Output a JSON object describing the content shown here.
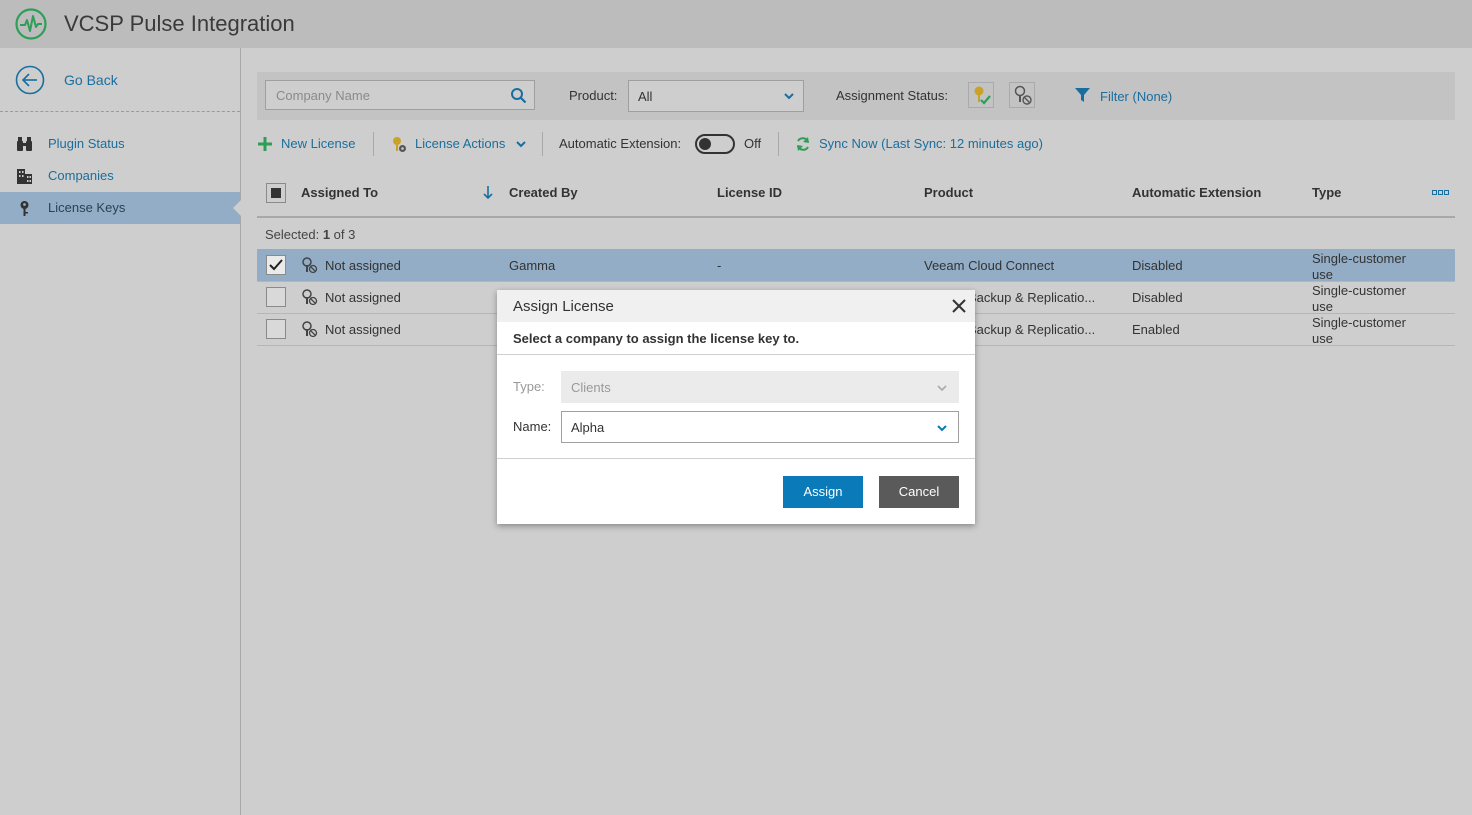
{
  "app": {
    "title": "VCSP Pulse Integration",
    "accent": "#2e9e57"
  },
  "sidebar": {
    "go_back": "Go Back",
    "items": [
      {
        "label": "Plugin Status",
        "icon": "binoculars-icon"
      },
      {
        "label": "Companies",
        "icon": "building-icon"
      },
      {
        "label": "License Keys",
        "icon": "key-icon",
        "active": true
      }
    ]
  },
  "filters": {
    "search_placeholder": "Company Name",
    "product_label": "Product:",
    "product_value": "All",
    "assignment_status_label": "Assignment Status:",
    "filter_link": "Filter (None)"
  },
  "toolbar": {
    "new_license": "New License",
    "license_actions": "License Actions",
    "auto_extension_label": "Automatic Extension:",
    "auto_extension_state": "Off",
    "sync_now": "Sync Now (Last Sync: 12 minutes ago)"
  },
  "table": {
    "columns": [
      "Assigned To",
      "Created By",
      "License ID",
      "Product",
      "Automatic Extension",
      "Type"
    ],
    "selection": {
      "prefix": "Selected: ",
      "count": "1",
      "suffix": " of 3"
    },
    "rows": [
      {
        "assigned_to": "Not assigned",
        "created_by": "Gamma",
        "license_id": "-",
        "product": "Veeam Cloud Connect",
        "auto_ext": "Disabled",
        "type": "Single-customer use",
        "selected": true
      },
      {
        "assigned_to": "Not assigned",
        "created_by": "",
        "license_id": "",
        "product": "Backup & Replicatio...",
        "auto_ext": "Disabled",
        "type": "Single-customer use",
        "selected": false
      },
      {
        "assigned_to": "Not assigned",
        "created_by": "",
        "license_id": "",
        "product": "Backup & Replicatio...",
        "auto_ext": "Enabled",
        "type": "Single-customer use",
        "selected": false
      }
    ]
  },
  "dialog": {
    "title": "Assign License",
    "subtitle": "Select a company to assign the license key to.",
    "type_label": "Type:",
    "type_value": "Clients",
    "name_label": "Name:",
    "name_value": "Alpha",
    "assign": "Assign",
    "cancel": "Cancel"
  }
}
